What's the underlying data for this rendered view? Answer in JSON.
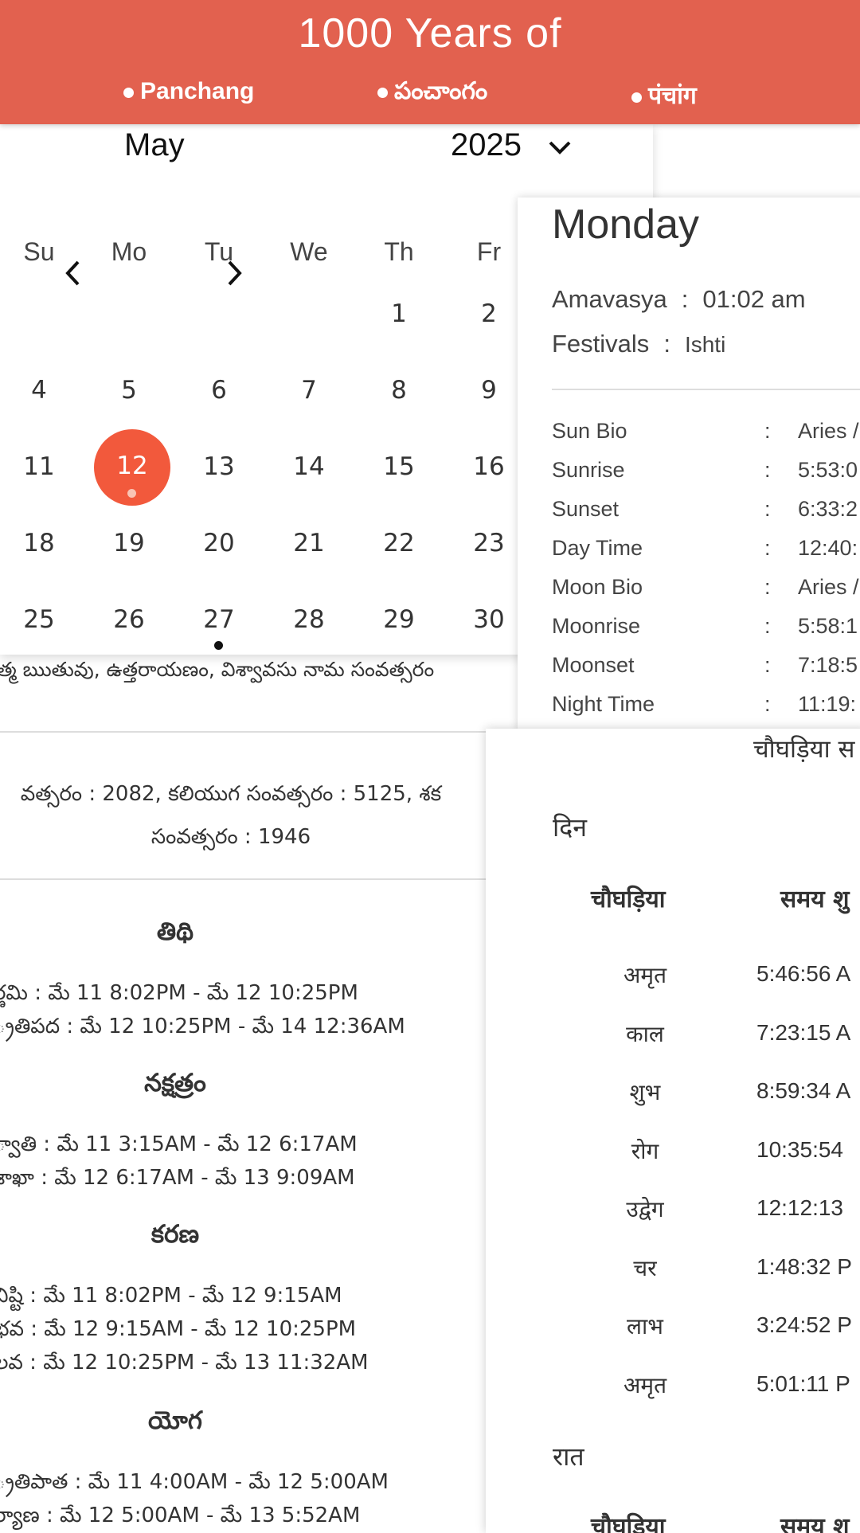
{
  "header": {
    "title": "1000 Years of",
    "tabs": [
      "Panchang",
      "పంచాంగం",
      "पंचांग"
    ]
  },
  "calendar": {
    "month": "May",
    "year": "2025",
    "weekdays": [
      "Su",
      "Mo",
      "Tu",
      "We",
      "Th",
      "Fr"
    ],
    "selected_day": "12",
    "rows": [
      [
        "",
        "",
        "",
        "",
        "1",
        "2"
      ],
      [
        "4",
        "5",
        "6",
        "7",
        "8",
        "9"
      ],
      [
        "11",
        "12",
        "13",
        "14",
        "15",
        "16"
      ],
      [
        "18",
        "19",
        "20",
        "21",
        "22",
        "23"
      ],
      [
        "25",
        "26",
        "27",
        "28",
        "29",
        "30"
      ]
    ]
  },
  "telugu_line": "త్మ ఋతువు, ఉత్తరాయణం, విశ్వావసు నామ సంవత్సరం",
  "samvatsara": {
    "line1": "వత్సరం : 2082, కలియుగ సంవత్సరం : 5125, శక",
    "line2": "సంవత్సరం : 1946"
  },
  "sections": [
    {
      "title": "తిథి",
      "lines": [
        "ర్ణమి : మే 11 8:02PM - మే 12 10:25PM",
        "్రతిపద : మే 12 10:25PM - మే 14 12:36AM"
      ]
    },
    {
      "title": "నక్షత్రం",
      "lines": [
        "్వాతి : మే 11 3:15AM - మే 12 6:17AM",
        "శాఖా : మే 12 6:17AM - మే 13 9:09AM"
      ]
    },
    {
      "title": "కరణ",
      "lines": [
        "విష్టి : మే 11 8:02PM - మే 12 9:15AM",
        "భవ : మే 12 9:15AM - మే 12 10:25PM",
        "లవ : మే 12 10:25PM - మే 13 11:32AM"
      ]
    },
    {
      "title": "యోగ",
      "lines": [
        "్రతిపాత : మే 11 4:00AM - మే 12 5:00AM",
        "ర్యాణ : మే 12 5:00AM - మే 13 5:52AM"
      ]
    }
  ],
  "detail": {
    "day_name": "Monday",
    "amavasya_label": "Amavasya",
    "amavasya_value": "01:02 am",
    "festivals_label": "Festivals",
    "festivals_value": "Ishti",
    "rows": [
      {
        "label": "Sun Bio",
        "value": "Aries /"
      },
      {
        "label": "Sunrise",
        "value": "5:53:0"
      },
      {
        "label": "Sunset",
        "value": "6:33:2"
      },
      {
        "label": "Day Time",
        "value": "12:40:"
      },
      {
        "label": "Moon Bio",
        "value": "Aries /"
      },
      {
        "label": "Moonrise",
        "value": "5:58:1"
      },
      {
        "label": "Moonset",
        "value": "7:18:5"
      },
      {
        "label": "Night Time",
        "value": "11:19:"
      }
    ]
  },
  "choghadiya": {
    "heading": "चौघड़िया स",
    "day_label": "दिन",
    "night_label": "रात",
    "col_name": "चौघड़िया",
    "col_time": "समय शु",
    "day_rows": [
      {
        "name": "अमृत",
        "time": "5:46:56 A"
      },
      {
        "name": "काल",
        "time": "7:23:15 A"
      },
      {
        "name": "शुभ",
        "time": "8:59:34 A"
      },
      {
        "name": "रोग",
        "time": "10:35:54"
      },
      {
        "name": "उद्वेग",
        "time": "12:12:13"
      },
      {
        "name": "चर",
        "time": "1:48:32 P"
      },
      {
        "name": "लाभ",
        "time": "3:24:52 P"
      },
      {
        "name": "अमृत",
        "time": "5:01:11 P"
      }
    ]
  }
}
